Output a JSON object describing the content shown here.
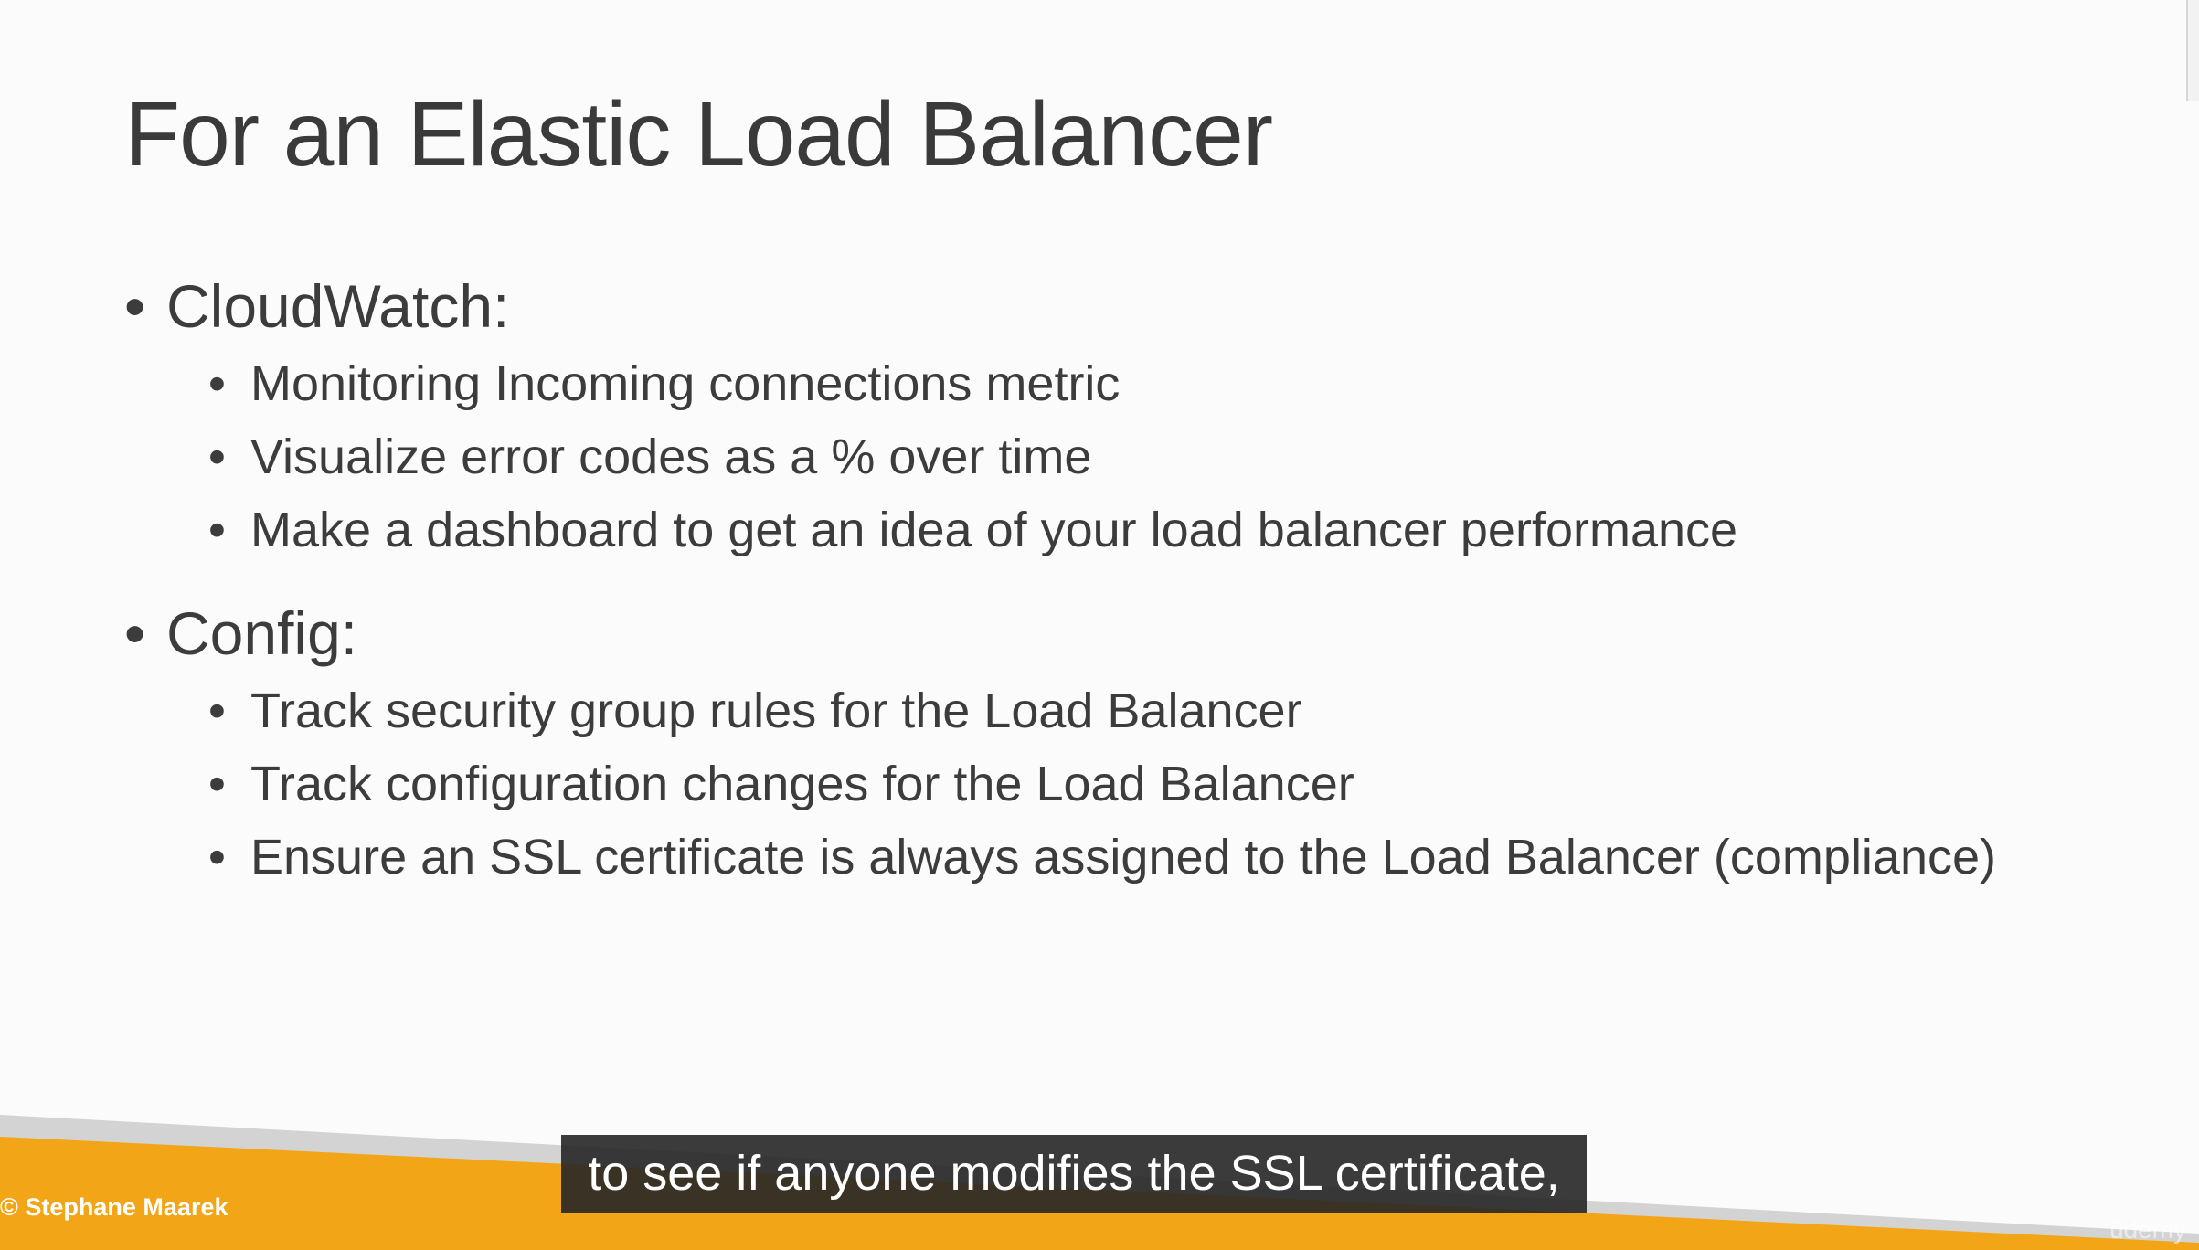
{
  "slide": {
    "title": "For an Elastic Load Balancer",
    "bullet_char": "•",
    "sections": [
      {
        "heading": "CloudWatch:",
        "items": [
          "Monitoring Incoming connections metric",
          "Visualize error codes as a % over time",
          "Make a dashboard to get an idea of your load balancer performance"
        ]
      },
      {
        "heading": "Config:",
        "items": [
          "Track security group rules for the Load Balancer",
          "Track configuration changes for the Load Balancer",
          "Ensure an SSL certificate is always assigned to the Load Balancer (compliance)"
        ]
      }
    ],
    "copyright": "© Stephane Maarek",
    "watermark": "ûdemy"
  },
  "video": {
    "caption": "to see if anyone modifies the SSL certificate,"
  },
  "colors": {
    "slide_background": "#fbfbfb",
    "text": "#3c3c3c",
    "footer_orange": "#f2a516",
    "footer_gray": "#d3d3d3",
    "caption_background": "#262626"
  }
}
